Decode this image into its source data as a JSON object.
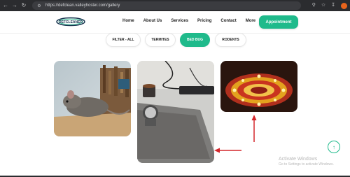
{
  "browser": {
    "url": "https://defclean.valleyhoster.com/gallery",
    "nav_icons": [
      "back-arrow",
      "forward-arrow",
      "reload"
    ],
    "right_icons": [
      "search",
      "star",
      "download",
      "profile"
    ]
  },
  "header": {
    "logo_text": "DEFCLEANER",
    "nav": [
      "Home",
      "About Us",
      "Services",
      "Pricing",
      "Contact",
      "More"
    ],
    "cta_label": "Appointment"
  },
  "filters": {
    "items": [
      "FILTER - ALL",
      "TERMITES",
      "BED BUG",
      "RODENTS"
    ],
    "active": "BED BUG"
  },
  "gallery": {
    "images": [
      "rat-on-table-photo",
      "desk-with-mug-and-watch-photo",
      "flower-rangoli-with-diyas-photo"
    ]
  },
  "annotations": {
    "arrows": [
      "red-arrow-up",
      "red-arrow-left"
    ]
  },
  "watermark": {
    "title": "Activate Windows",
    "subtitle": "Go to Settings to activate Windows."
  },
  "colors": {
    "accent": "#1fba8b",
    "arrow": "#d4262b",
    "chrome": "#2b2c2f"
  }
}
